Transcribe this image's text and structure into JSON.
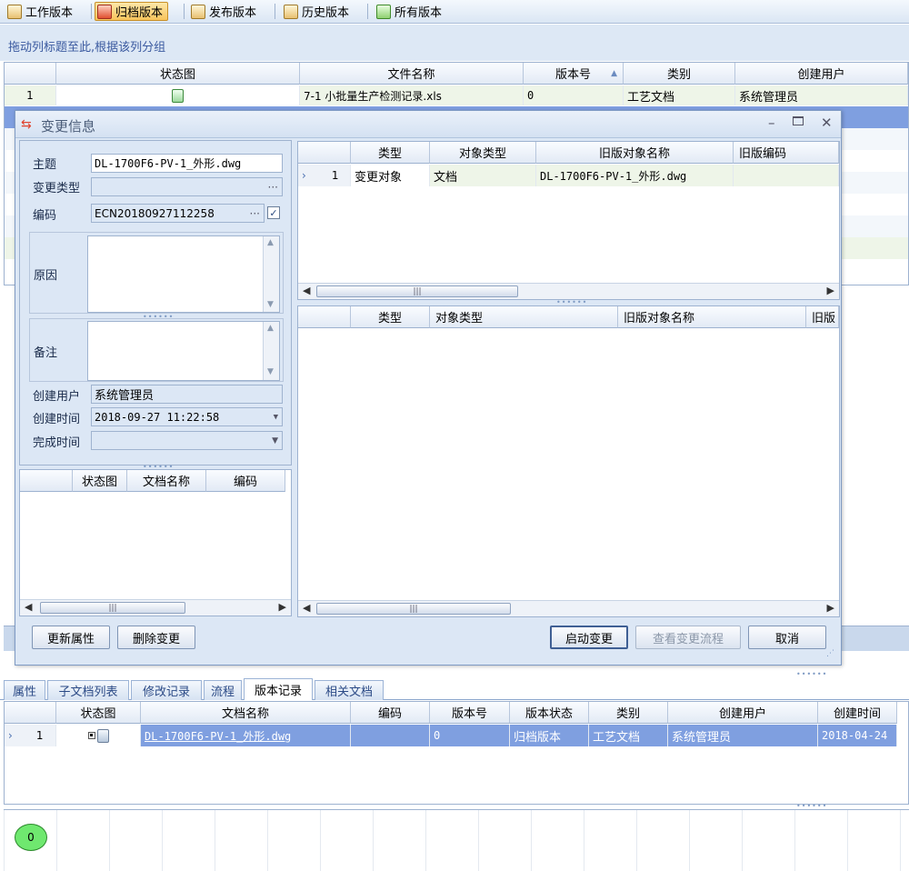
{
  "toolbar": {
    "buttons": [
      {
        "label": "工作版本"
      },
      {
        "label": "归档版本"
      },
      {
        "label": "发布版本"
      },
      {
        "label": "历史版本"
      },
      {
        "label": "所有版本"
      }
    ]
  },
  "group_panel": {
    "text": "拖动列标题至此,根据该列分组"
  },
  "main_grid": {
    "columns": [
      "状态图",
      "文件名称",
      "版本号",
      "类别",
      "创建用户"
    ],
    "rows": [
      {
        "no": "1",
        "file": "7-1 小批量生产检测记录.xls",
        "version": "0",
        "category": "工艺文档",
        "user": "系统管理员"
      }
    ]
  },
  "dialog": {
    "title": "变更信息",
    "form": {
      "subject_label": "主题",
      "subject_value": "DL-1700F6-PV-1_外形.dwg",
      "change_type_label": "变更类型",
      "code_label": "编码",
      "code_value": "ECN20180927112258",
      "reason_label": "原因",
      "remark_label": "备注",
      "creator_label": "创建用户",
      "creator_value": "系统管理员",
      "created_time_label": "创建时间",
      "created_time_value": "2018-09-27 11:22:58",
      "finished_time_label": "完成时间",
      "ellipsis": "···",
      "checkbox": "✓"
    },
    "left_grid": {
      "columns": [
        "状态图",
        "文档名称",
        "编码"
      ]
    },
    "top_grid": {
      "columns": [
        "类型",
        "对象类型",
        "旧版对象名称",
        "旧版编码"
      ],
      "rows": [
        {
          "no": "1",
          "type": "变更对象",
          "object_type": "文档",
          "old_name": "DL-1700F6-PV-1_外形.dwg",
          "old_code": ""
        }
      ]
    },
    "bottom_grid": {
      "columns": [
        "类型",
        "对象类型",
        "旧版对象名称",
        "旧版"
      ]
    },
    "buttons": {
      "update": "更新属性",
      "delete": "删除变更",
      "start": "启动变更",
      "view_flow": "查看变更流程",
      "cancel": "取消"
    }
  },
  "tabs": [
    "属性",
    "子文档列表",
    "修改记录",
    "流程",
    "版本记录",
    "相关文档"
  ],
  "active_tab": "版本记录",
  "version_grid": {
    "columns": [
      "状态图",
      "文档名称",
      "编码",
      "版本号",
      "版本状态",
      "类别",
      "创建用户",
      "创建时间"
    ],
    "rows": [
      {
        "no": "1",
        "name": "DL-1700F6-PV-1_外形.dwg",
        "code": "",
        "version": "0",
        "status": "归档版本",
        "category": "工艺文档",
        "user": "系统管理员",
        "time": "2018-04-24"
      }
    ]
  },
  "flow": {
    "node_label": "0"
  }
}
